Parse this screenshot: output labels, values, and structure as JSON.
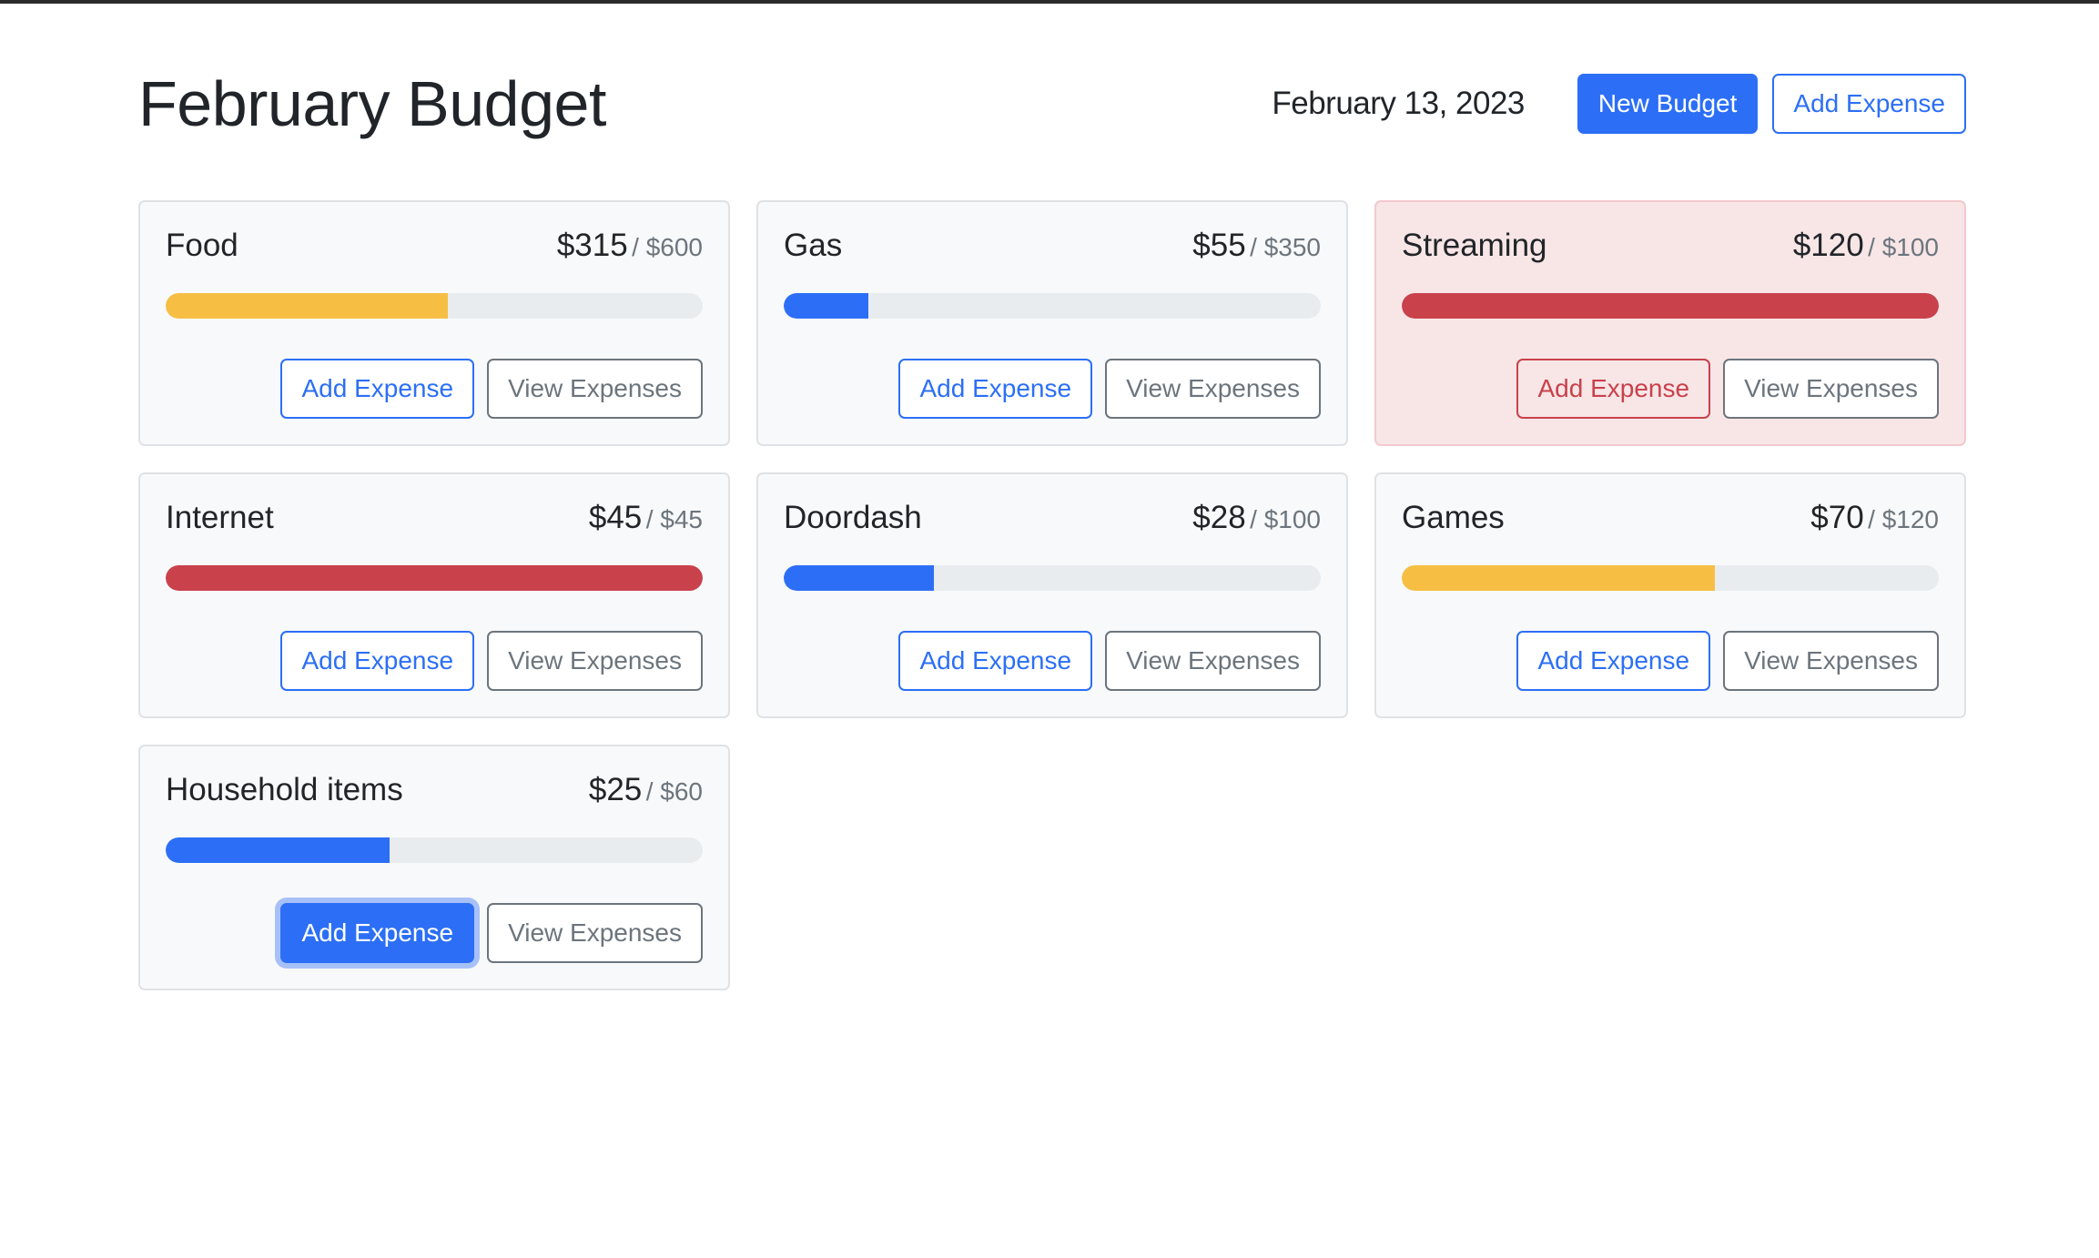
{
  "header": {
    "title": "February Budget",
    "date": "February 13, 2023",
    "new_budget_label": "New Budget",
    "add_expense_label": "Add Expense"
  },
  "colors": {
    "primary": "#2c6ff6",
    "warning": "#f6bf44",
    "danger": "#c9414b",
    "track": "#e9ecef"
  },
  "budgets": [
    {
      "name": "Food",
      "amount": "$315",
      "max": "/ $600",
      "progress": 0.525,
      "status": "warning",
      "add_label": "Add Expense",
      "view_label": "View Expenses"
    },
    {
      "name": "Gas",
      "amount": "$55",
      "max": "/ $350",
      "progress": 0.157,
      "status": "primary",
      "add_label": "Add Expense",
      "view_label": "View Expenses"
    },
    {
      "name": "Streaming",
      "amount": "$120",
      "max": "/ $100",
      "progress": 1.0,
      "status": "danger",
      "add_label": "Add Expense",
      "view_label": "View Expenses"
    },
    {
      "name": "Internet",
      "amount": "$45",
      "max": "/ $45",
      "progress": 1.0,
      "status": "danger",
      "add_label": "Add Expense",
      "view_label": "View Expenses"
    },
    {
      "name": "Doordash",
      "amount": "$28",
      "max": "/ $100",
      "progress": 0.28,
      "status": "primary",
      "add_label": "Add Expense",
      "view_label": "View Expenses"
    },
    {
      "name": "Games",
      "amount": "$70",
      "max": "/ $120",
      "progress": 0.583,
      "status": "warning",
      "add_label": "Add Expense",
      "view_label": "View Expenses"
    },
    {
      "name": "Household items",
      "amount": "$25",
      "max": "/ $60",
      "progress": 0.417,
      "status": "primary",
      "add_label": "Add Expense",
      "view_label": "View Expenses"
    }
  ]
}
